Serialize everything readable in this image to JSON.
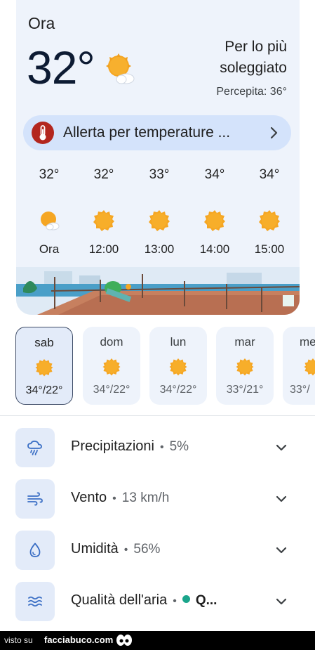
{
  "current": {
    "label": "Ora",
    "temperature": "32°",
    "condition": "Per lo più soleggiato",
    "feels_like": "Percepita: 36°",
    "icon": "partly-sunny-icon"
  },
  "alert": {
    "text": "Allerta per temperature ...",
    "icon": "thermometer-icon",
    "color": "#b3261e"
  },
  "hourly": [
    {
      "temp": "32°",
      "time": "Ora",
      "icon": "partly-sunny-icon"
    },
    {
      "temp": "32°",
      "time": "12:00",
      "icon": "sun-icon"
    },
    {
      "temp": "33°",
      "time": "13:00",
      "icon": "sun-icon"
    },
    {
      "temp": "34°",
      "time": "14:00",
      "icon": "sun-icon"
    },
    {
      "temp": "34°",
      "time": "15:00",
      "icon": "sun-icon"
    }
  ],
  "days": [
    {
      "name": "sab",
      "range": "34°/22°",
      "selected": true,
      "icon": "sun-icon"
    },
    {
      "name": "dom",
      "range": "34°/22°",
      "selected": false,
      "icon": "sun-icon"
    },
    {
      "name": "lun",
      "range": "34°/22°",
      "selected": false,
      "icon": "sun-icon"
    },
    {
      "name": "mar",
      "range": "33°/21°",
      "selected": false,
      "icon": "sun-icon"
    },
    {
      "name": "me",
      "range": "33°/",
      "selected": false,
      "icon": "sun-icon"
    }
  ],
  "details": [
    {
      "label": "Precipitazioni",
      "value": "5%",
      "icon": "rain-cloud-icon"
    },
    {
      "label": "Vento",
      "value": "13 km/h",
      "icon": "wind-icon"
    },
    {
      "label": "Umidità",
      "value": "56%",
      "icon": "droplet-icon"
    },
    {
      "label": "Qualità dell'aria",
      "value": "Q...",
      "icon": "air-quality-icon",
      "status_color": "#1aa58b"
    }
  ],
  "footer": {
    "prefix": "visto su",
    "site": "facciabuco.com"
  },
  "colors": {
    "card_bg": "#eef3fb",
    "alert_bg": "#d4e3fb",
    "sun": "#f5a623"
  }
}
